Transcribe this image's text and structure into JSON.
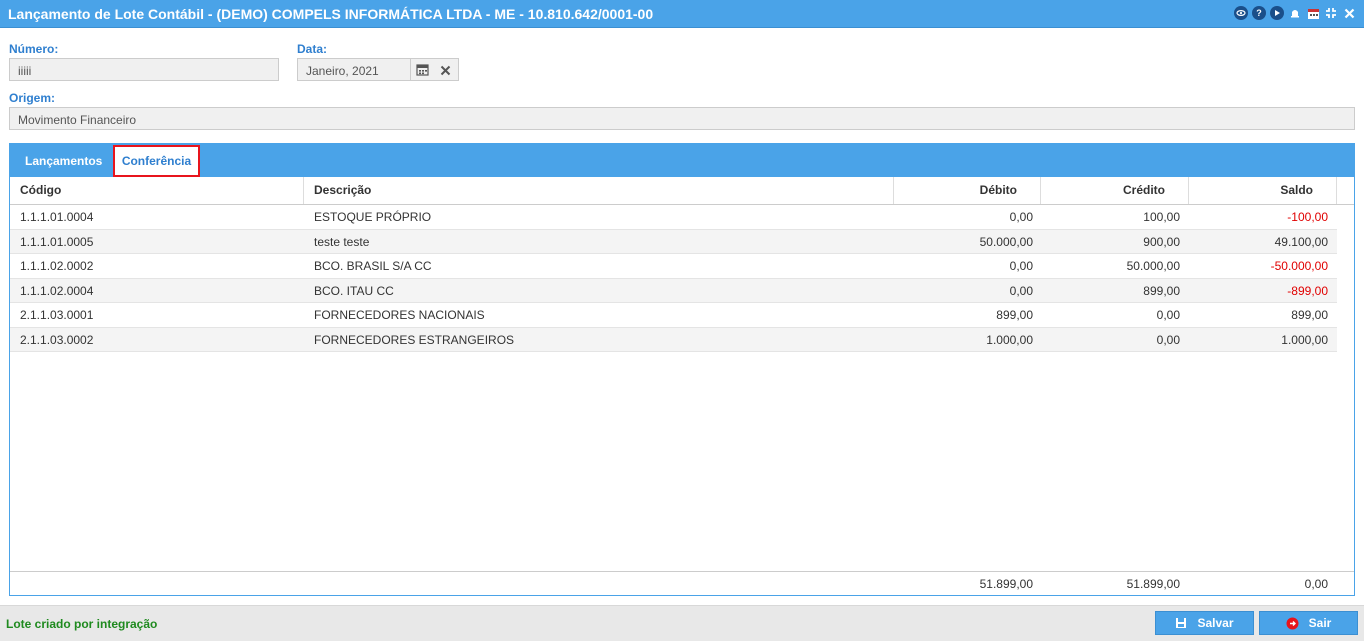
{
  "window": {
    "title": "Lançamento de Lote Contábil - (DEMO) COMPELS INFORMÁTICA LTDA - ME - 10.810.642/0001-00",
    "icons": [
      "eye-icon",
      "help-icon",
      "play-icon",
      "bell-icon",
      "calendar-icon",
      "minimize-icon",
      "close-icon"
    ]
  },
  "form": {
    "numero_label": "Número:",
    "numero_value": "iiiii",
    "data_label": "Data:",
    "data_value": "Janeiro, 2021",
    "origem_label": "Origem:",
    "origem_value": "Movimento Financeiro"
  },
  "tabs": [
    {
      "label": "Lançamentos",
      "active": false
    },
    {
      "label": "Conferência",
      "active": true
    }
  ],
  "table": {
    "columns": [
      "Código",
      "Descrição",
      "Débito",
      "Crédito",
      "Saldo"
    ],
    "rows": [
      {
        "codigo": "1.1.1.01.0004",
        "descricao": "ESTOQUE PRÓPRIO",
        "debito": "0,00",
        "credito": "100,00",
        "saldo": "-100,00",
        "negative": true
      },
      {
        "codigo": "1.1.1.01.0005",
        "descricao": "teste teste",
        "debito": "50.000,00",
        "credito": "900,00",
        "saldo": "49.100,00",
        "negative": false
      },
      {
        "codigo": "1.1.1.02.0002",
        "descricao": "BCO. BRASIL S/A CC",
        "debito": "0,00",
        "credito": "50.000,00",
        "saldo": "-50.000,00",
        "negative": true
      },
      {
        "codigo": "1.1.1.02.0004",
        "descricao": "BCO. ITAU CC",
        "debito": "0,00",
        "credito": "899,00",
        "saldo": "-899,00",
        "negative": true
      },
      {
        "codigo": "2.1.1.03.0001",
        "descricao": "FORNECEDORES NACIONAIS",
        "debito": "899,00",
        "credito": "0,00",
        "saldo": "899,00",
        "negative": false
      },
      {
        "codigo": "2.1.1.03.0002",
        "descricao": "FORNECEDORES ESTRANGEIROS",
        "debito": "1.000,00",
        "credito": "0,00",
        "saldo": "1.000,00",
        "negative": false
      }
    ],
    "totals": {
      "debito": "51.899,00",
      "credito": "51.899,00",
      "saldo": "0,00"
    }
  },
  "footer": {
    "status": "Lote criado por integração",
    "save_label": "Salvar",
    "exit_label": "Sair"
  },
  "colors": {
    "header_bg": "#4aa3e8",
    "label_blue": "#2f7fcf",
    "negative": "#e00000",
    "status_green": "#1f8a1f",
    "active_tab_border": "#e8141c"
  }
}
